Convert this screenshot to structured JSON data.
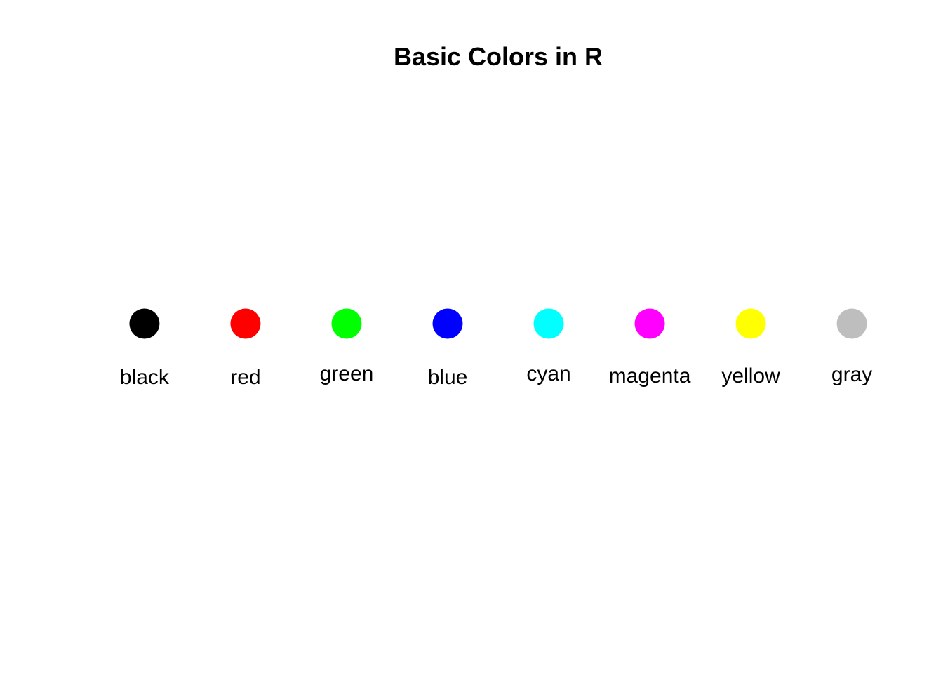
{
  "chart_data": {
    "type": "scatter",
    "title": "Basic Colors in R",
    "xlabel": "",
    "ylabel": "",
    "axes": "none",
    "grid": false,
    "legend": "none",
    "xlim": [
      0.5,
      8.5
    ],
    "ylim": [
      -2,
      2
    ],
    "points": [
      {
        "x": 1,
        "y": 0,
        "label": "black",
        "color": "#000000"
      },
      {
        "x": 2,
        "y": 0,
        "label": "red",
        "color": "#FF0000"
      },
      {
        "x": 3,
        "y": 0,
        "label": "green",
        "color": "#00FF00"
      },
      {
        "x": 4,
        "y": 0,
        "label": "blue",
        "color": "#0000FF"
      },
      {
        "x": 5,
        "y": 0,
        "label": "cyan",
        "color": "#00FFFF"
      },
      {
        "x": 6,
        "y": 0,
        "label": "magenta",
        "color": "#FF00FF"
      },
      {
        "x": 7,
        "y": 0,
        "label": "yellow",
        "color": "#FFFF00"
      },
      {
        "x": 8,
        "y": 0,
        "label": "gray",
        "color": "#BEBEBE"
      }
    ]
  }
}
